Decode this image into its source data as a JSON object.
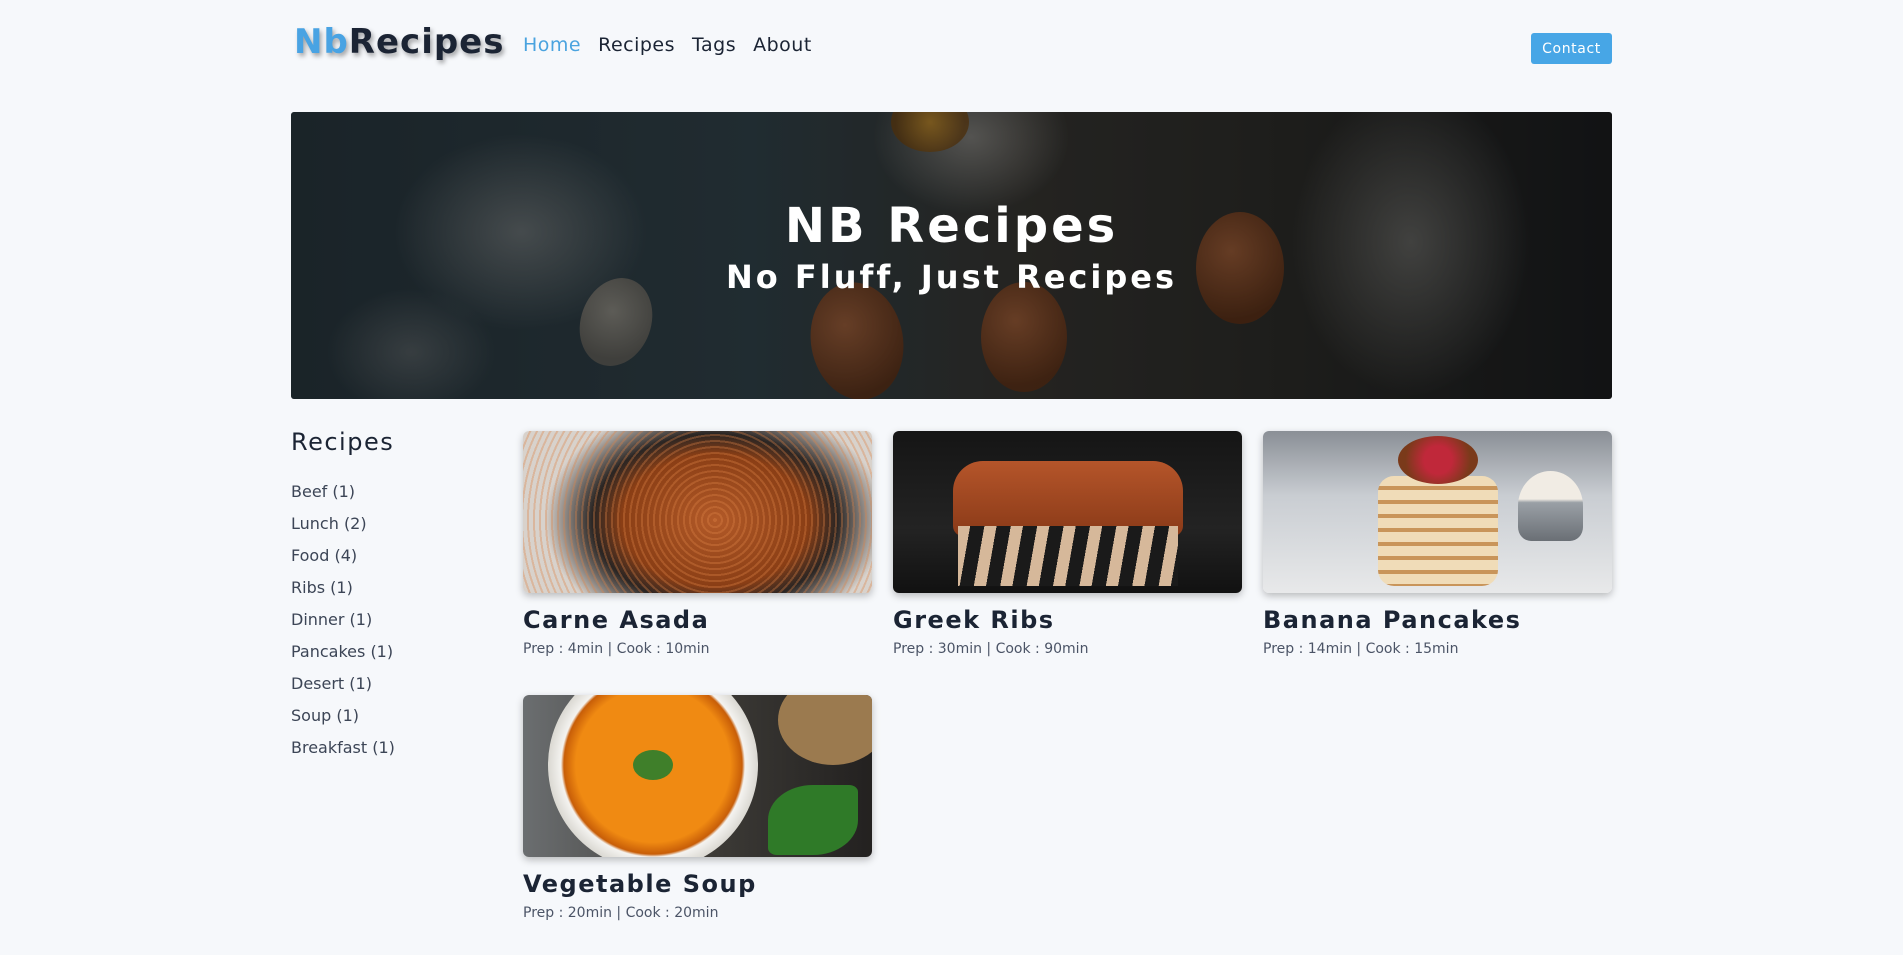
{
  "header": {
    "logo_nb": "Nb",
    "logo_rest": "Recipes",
    "nav": [
      "Home",
      "Recipes",
      "Tags",
      "About"
    ],
    "active_nav": "Home",
    "contact_label": "Contact"
  },
  "hero": {
    "title": "NB Recipes",
    "subtitle": "No Fluff, Just Recipes"
  },
  "sidebar": {
    "heading": "Recipes",
    "tags": [
      "Beef (1)",
      "Lunch (2)",
      "Food (4)",
      "Ribs (1)",
      "Dinner (1)",
      "Pancakes (1)",
      "Desert (1)",
      "Soup (1)",
      "Breakfast (1)"
    ]
  },
  "recipes": [
    {
      "title": "Carne Asada",
      "meta": "Prep : 4min | Cook : 10min"
    },
    {
      "title": "Greek Ribs",
      "meta": "Prep : 30min | Cook : 90min"
    },
    {
      "title": "Banana Pancakes",
      "meta": "Prep : 14min | Cook : 15min"
    },
    {
      "title": "Vegetable Soup",
      "meta": "Prep : 20min | Cook : 20min"
    }
  ],
  "colors": {
    "accent": "#47a6e6",
    "text": "#1b2434",
    "background": "#f6f8fb"
  }
}
